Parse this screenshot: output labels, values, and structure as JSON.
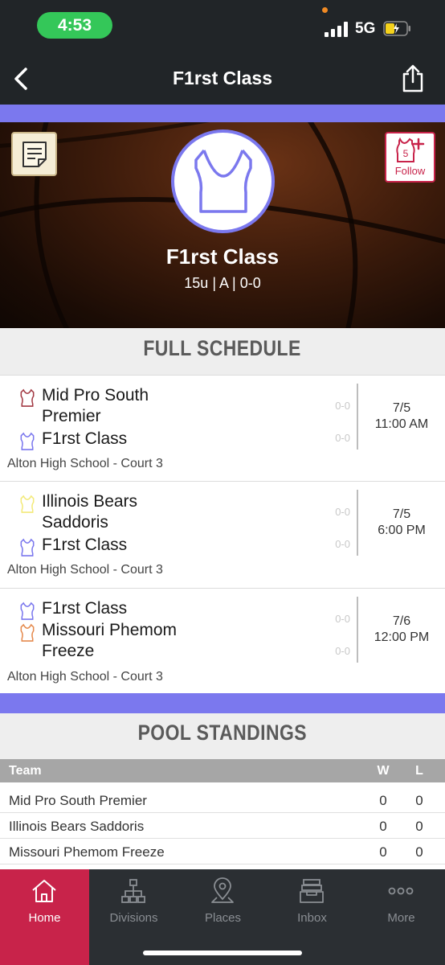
{
  "status_bar": {
    "time": "4:53",
    "network": "5G"
  },
  "nav": {
    "title": "F1rst Class"
  },
  "hero": {
    "team_name": "F1rst Class",
    "subtitle": "15u | A | 0-0",
    "follow_label": "Follow",
    "follow_count": "5"
  },
  "schedule": {
    "header": "FULL SCHEDULE",
    "games": [
      {
        "team1": "Mid Pro South Premier",
        "team1_color": "#a33a44",
        "team1_score": "0-0",
        "team2": "F1rst Class",
        "team2_color": "#7b78ee",
        "team2_score": "0-0",
        "date": "7/5",
        "time": "11:00 AM",
        "location": "Alton High School - Court 3"
      },
      {
        "team1": "Illinois Bears Saddoris",
        "team1_color": "#f3ea7a",
        "team1_score": "0-0",
        "team2": "F1rst Class",
        "team2_color": "#7b78ee",
        "team2_score": "0-0",
        "date": "7/5",
        "time": "6:00 PM",
        "location": "Alton High School - Court 3"
      },
      {
        "team1": "F1rst Class",
        "team1_color": "#7b78ee",
        "team1_score": "0-0",
        "team2": "Missouri Phemom Freeze",
        "team2_color": "#e58a4e",
        "team2_score": "0-0",
        "date": "7/6",
        "time": "12:00 PM",
        "location": "Alton High School - Court 3"
      }
    ]
  },
  "standings": {
    "header": "POOL STANDINGS",
    "columns": {
      "team": "Team",
      "w": "W",
      "l": "L"
    },
    "rows": [
      {
        "team": "Mid Pro South Premier",
        "w": "0",
        "l": "0"
      },
      {
        "team": "Illinois Bears Saddoris",
        "w": "0",
        "l": "0"
      },
      {
        "team": "Missouri Phemom Freeze",
        "w": "0",
        "l": "0"
      }
    ]
  },
  "tabs": [
    {
      "label": "Home",
      "icon": "home-icon",
      "active": true
    },
    {
      "label": "Divisions",
      "icon": "divisions-icon",
      "active": false
    },
    {
      "label": "Places",
      "icon": "places-icon",
      "active": false
    },
    {
      "label": "Inbox",
      "icon": "inbox-icon",
      "active": false
    },
    {
      "label": "More",
      "icon": "more-icon",
      "active": false
    }
  ],
  "colors": {
    "accent": "#7b78ee",
    "brand_red": "#c8234a",
    "nav_bg": "#212528",
    "tab_bg": "#2b2f33"
  }
}
